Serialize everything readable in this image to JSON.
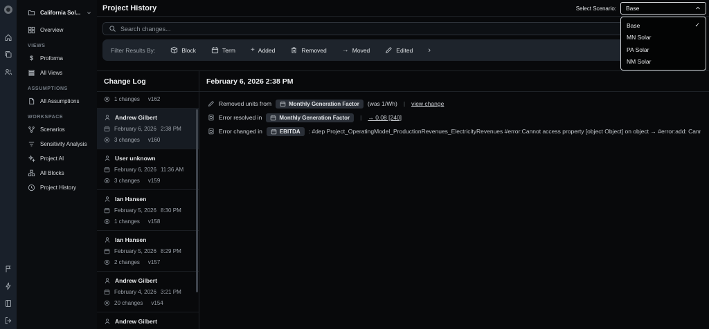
{
  "header": {
    "title": "Project History",
    "scenario_label": "Select Scenario:",
    "scenario_value": "Base"
  },
  "scenario_menu": {
    "items": [
      {
        "label": "Base",
        "checked": true
      },
      {
        "label": "MN Solar",
        "checked": false
      },
      {
        "label": "PA Solar",
        "checked": false
      },
      {
        "label": "NM Solar",
        "checked": false
      }
    ],
    "check_glyph": "✓"
  },
  "search": {
    "placeholder": "Search changes..."
  },
  "filters": {
    "label": "Filter Results By:",
    "items": [
      {
        "icon": "block-cube-icon",
        "label": "Block"
      },
      {
        "icon": "calendar-icon",
        "label": "Term"
      },
      {
        "icon": "plus-icon",
        "label": "Added"
      },
      {
        "icon": "trash-icon",
        "label": "Removed"
      },
      {
        "icon": "arrow-right-icon",
        "label": "Moved"
      },
      {
        "icon": "pencil-icon",
        "label": "Edited"
      }
    ],
    "plus_glyph": "+",
    "arrow_glyph": "→",
    "chevron_glyph": "›"
  },
  "sidebar": {
    "project": "California Sol...",
    "overview": "Overview",
    "sections": [
      {
        "title": "VIEWS",
        "items": [
          {
            "label": "Proforma"
          },
          {
            "label": "All Views"
          }
        ]
      },
      {
        "title": "ASSUMPTIONS",
        "items": [
          {
            "label": "All Assumptions"
          }
        ]
      },
      {
        "title": "WORKSPACE",
        "items": [
          {
            "label": "Scenarios"
          },
          {
            "label": "Sensitivity Analysis"
          },
          {
            "label": "Project AI"
          },
          {
            "label": "All Blocks"
          },
          {
            "label": "Project History"
          }
        ]
      }
    ],
    "dollar_glyph": "$"
  },
  "changelog": {
    "title": "Change Log",
    "partial_top": {
      "changes": "1 changes",
      "version": "v162"
    },
    "entries": [
      {
        "name": "Andrew Gilbert",
        "date": "February 6, 2026",
        "time": "2:38 PM",
        "changes": "3 changes",
        "version": "v160",
        "selected": true
      },
      {
        "name": "User unknown",
        "date": "February 6, 2026",
        "time": "11:36 AM",
        "changes": "3 changes",
        "version": "v159",
        "selected": false
      },
      {
        "name": "Ian Hansen",
        "date": "February 5, 2026",
        "time": "8:30 PM",
        "changes": "1 changes",
        "version": "v158",
        "selected": false
      },
      {
        "name": "Ian Hansen",
        "date": "February 5, 2026",
        "time": "8:29 PM",
        "changes": "2 changes",
        "version": "v157",
        "selected": false
      },
      {
        "name": "Andrew Gilbert",
        "date": "February 4, 2026",
        "time": "3:21 PM",
        "changes": "20 changes",
        "version": "v154",
        "selected": false
      }
    ],
    "partial_bottom": {
      "name": "Andrew Gilbert"
    }
  },
  "detail": {
    "title": "February 6, 2026 2:38 PM",
    "rows": [
      {
        "action": "Removed units from",
        "block": "Monthly Generation Factor",
        "was": "(was 1/Wh)",
        "sep": "|",
        "link": "view change"
      },
      {
        "action": "Error resolved in",
        "block": "Monthly Generation Factor",
        "sep": "|",
        "link": "→ 0.08 [240]"
      },
      {
        "action": "Error changed in",
        "block": "EBITDA",
        "error_text": ": #dep Project_OperatingModel_ProductionRevenues_ElectricityRevenues #error:Cannot access property [object Object] on object → #error:add: Cannot convert unit \"USD\" to \"USD/MWh\""
      }
    ]
  }
}
